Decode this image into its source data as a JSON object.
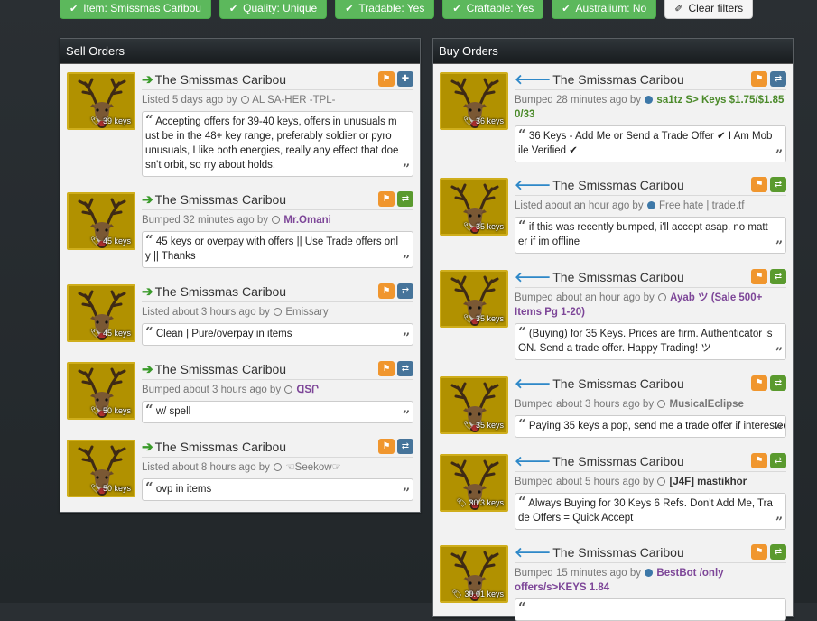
{
  "filters": [
    {
      "label": "Item: Smissmas Caribou"
    },
    {
      "label": "Quality: Unique"
    },
    {
      "label": "Tradable: Yes"
    },
    {
      "label": "Craftable: Yes"
    },
    {
      "label": "Australium: No"
    }
  ],
  "clear_filters": "Clear filters",
  "sell": {
    "header": "Sell Orders",
    "listings": [
      {
        "title": "The Smissmas Caribou",
        "price": "39 keys",
        "status": "Listed 5 days ago by",
        "user": "AL SA-HER -TPL-",
        "comment": "Accepting offers for 39-40 keys, offers in unusuals must be in the 48+ key range, preferably soldier or pyro unusuals, I like both energies, really any effect that doesn't orbit, so rry about holds."
      },
      {
        "title": "The Smissmas Caribou",
        "price": "45 keys",
        "status": "Bumped 32 minutes ago by",
        "user": "Mr.Omani",
        "comment": "45 keys or overpay with offers || Use Trade offers only || Thanks"
      },
      {
        "title": "The Smissmas Caribou",
        "price": "45 keys",
        "status": "Listed about 3 hours ago by",
        "user": "Emissary",
        "comment": "Clean | Pure/overpay in items"
      },
      {
        "title": "The Smissmas Caribou",
        "price": "50 keys",
        "status": "Bumped about 3 hours ago by",
        "user": "ᗡSՐ",
        "comment": "w/ spell"
      },
      {
        "title": "The Smissmas Caribou",
        "price": "50 keys",
        "status": "Listed about 8 hours ago by",
        "user": "☜Seekow☞",
        "comment": "ovp in items"
      }
    ]
  },
  "buy": {
    "header": "Buy Orders",
    "listings": [
      {
        "title": "The Smissmas Caribou",
        "price": "36 keys",
        "status": "Bumped 28 minutes ago by",
        "user": "sa1tz S> Keys $1.75/$1.85 0/33",
        "comment": "36 Keys - Add Me or Send a Trade Offer ✔ I Am Mobile Verified ✔"
      },
      {
        "title": "The Smissmas Caribou",
        "price": "35 keys",
        "status": "Listed about an hour ago by",
        "user": "Free hate | trade.tf",
        "comment": "if this was recently bumped, i'll accept asap. no matter if im offline"
      },
      {
        "title": "The Smissmas Caribou",
        "price": "35 keys",
        "status": "Bumped about an hour ago by",
        "user": "Ayab ツ (Sale 500+ Items Pg 1-20)",
        "comment": "(Buying) for 35 Keys. Prices are firm. Authenticator is ON. Send a trade offer. Happy Trading! ツ"
      },
      {
        "title": "The Smissmas Caribou",
        "price": "35 keys",
        "status": "Bumped about 3 hours ago by",
        "user": "MusicalEclipse",
        "comment": "Paying 35 keys a pop, send me a trade offer if interested"
      },
      {
        "title": "The Smissmas Caribou",
        "price": "30.3 keys",
        "status": "Bumped about 5 hours ago by",
        "user": "[J4F] mastikhor",
        "comment": "Always Buying for 30 Keys 6 Refs. Don't Add Me, Trade Offers = Quick Accept"
      },
      {
        "title": "The Smissmas Caribou",
        "price": "30.01 keys",
        "status": "Bumped 15 minutes ago by",
        "user": "BestBot /only offers/s>KEYS 1.84",
        "comment": ""
      }
    ]
  }
}
